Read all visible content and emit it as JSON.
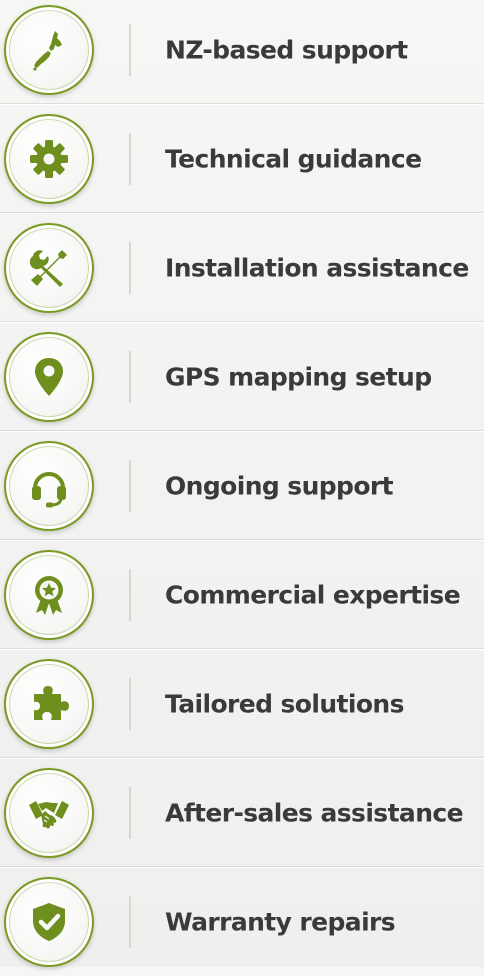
{
  "accent_color": "#6e8e1e",
  "items": [
    {
      "label": "NZ-based support",
      "icon": "new-zealand-map-icon"
    },
    {
      "label": "Technical guidance",
      "icon": "gear-icon"
    },
    {
      "label": "Installation assistance",
      "icon": "wrench-screwdriver-icon"
    },
    {
      "label": "GPS mapping setup",
      "icon": "map-pin-icon"
    },
    {
      "label": "Ongoing support",
      "icon": "headset-icon"
    },
    {
      "label": "Commercial expertise",
      "icon": "award-ribbon-icon"
    },
    {
      "label": "Tailored solutions",
      "icon": "puzzle-piece-icon"
    },
    {
      "label": "After-sales assistance",
      "icon": "handshake-icon"
    },
    {
      "label": "Warranty repairs",
      "icon": "shield-check-icon"
    }
  ]
}
